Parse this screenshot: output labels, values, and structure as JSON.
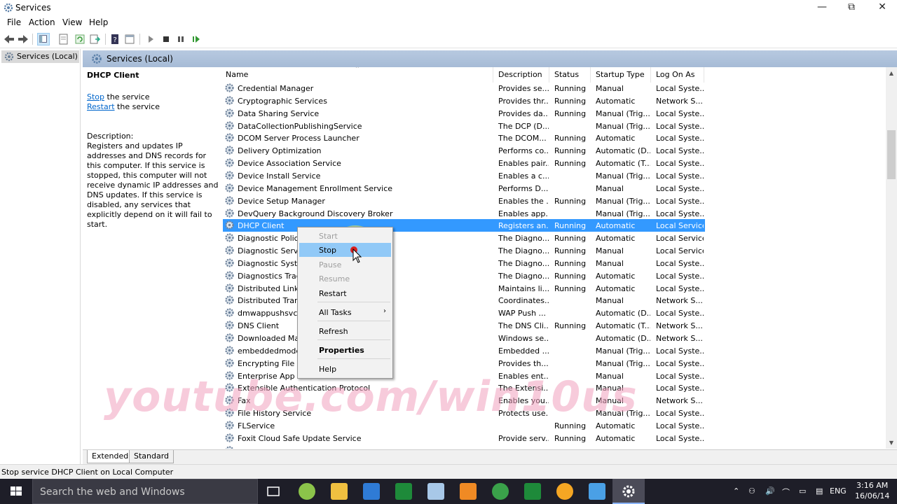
{
  "window": {
    "title": "Services",
    "minimize": "—",
    "maximize": "⧉",
    "close": "✕"
  },
  "menu": [
    "File",
    "Action",
    "View",
    "Help"
  ],
  "tree": {
    "item": "Services (Local)"
  },
  "pane": {
    "header": "Services (Local)",
    "detail": {
      "title": "DHCP Client",
      "stop_link": "Stop",
      "stop_rest": " the service",
      "restart_link": "Restart",
      "restart_rest": " the service",
      "description_label": "Description:",
      "description": "Registers and updates IP addresses and DNS records for this computer. If this service is stopped, this computer will not receive dynamic IP addresses and DNS updates. If this service is disabled, any services that explicitly depend on it will fail to start."
    },
    "columns": {
      "name": "Name",
      "description": "Description",
      "status": "Status",
      "startup": "Startup Type",
      "logon": "Log On As"
    },
    "rows": [
      {
        "name": "Credential Manager",
        "desc": "Provides se...",
        "status": "Running",
        "startup": "Manual",
        "logon": "Local Syste..."
      },
      {
        "name": "Cryptographic Services",
        "desc": "Provides thr...",
        "status": "Running",
        "startup": "Automatic",
        "logon": "Network S..."
      },
      {
        "name": "Data Sharing Service",
        "desc": "Provides da...",
        "status": "Running",
        "startup": "Manual (Trig...",
        "logon": "Local Syste..."
      },
      {
        "name": "DataCollectionPublishingService",
        "desc": "The DCP (D...",
        "status": "",
        "startup": "Manual (Trig...",
        "logon": "Local Syste..."
      },
      {
        "name": "DCOM Server Process Launcher",
        "desc": "The DCOM...",
        "status": "Running",
        "startup": "Automatic",
        "logon": "Local Syste..."
      },
      {
        "name": "Delivery Optimization",
        "desc": "Performs co...",
        "status": "Running",
        "startup": "Automatic (D...",
        "logon": "Local Syste..."
      },
      {
        "name": "Device Association Service",
        "desc": "Enables pair...",
        "status": "Running",
        "startup": "Automatic (T...",
        "logon": "Local Syste..."
      },
      {
        "name": "Device Install Service",
        "desc": "Enables a c...",
        "status": "",
        "startup": "Manual (Trig...",
        "logon": "Local Syste..."
      },
      {
        "name": "Device Management Enrollment Service",
        "desc": "Performs D...",
        "status": "",
        "startup": "Manual",
        "logon": "Local Syste..."
      },
      {
        "name": "Device Setup Manager",
        "desc": "Enables the ...",
        "status": "Running",
        "startup": "Manual (Trig...",
        "logon": "Local Syste..."
      },
      {
        "name": "DevQuery Background Discovery Broker",
        "desc": "Enables app...",
        "status": "",
        "startup": "Manual (Trig...",
        "logon": "Local Syste..."
      },
      {
        "name": "DHCP Client",
        "desc": "Registers an...",
        "status": "Running",
        "startup": "Automatic",
        "logon": "Local Service"
      },
      {
        "name": "Diagnostic Policy",
        "desc": "The Diagno...",
        "status": "Running",
        "startup": "Automatic",
        "logon": "Local Service"
      },
      {
        "name": "Diagnostic Servic",
        "desc": "The Diagno...",
        "status": "Running",
        "startup": "Manual",
        "logon": "Local Service"
      },
      {
        "name": "Diagnostic Syster",
        "desc": "The Diagno...",
        "status": "Running",
        "startup": "Manual",
        "logon": "Local Syste..."
      },
      {
        "name": "Diagnostics Track",
        "desc": "The Diagno...",
        "status": "Running",
        "startup": "Automatic",
        "logon": "Local Syste..."
      },
      {
        "name": "Distributed Link T",
        "desc": "Maintains li...",
        "status": "Running",
        "startup": "Automatic",
        "logon": "Local Syste..."
      },
      {
        "name": "Distributed Trans",
        "desc": "Coordinates...",
        "status": "",
        "startup": "Manual",
        "logon": "Network S..."
      },
      {
        "name": "dmwappushsvc",
        "desc": "WAP Push ...",
        "status": "",
        "startup": "Automatic (D...",
        "logon": "Local Syste..."
      },
      {
        "name": "DNS Client",
        "desc": "The DNS Cli...",
        "status": "Running",
        "startup": "Automatic (T...",
        "logon": "Network S..."
      },
      {
        "name": "Downloaded Ma",
        "desc": "Windows se...",
        "status": "",
        "startup": "Automatic (D...",
        "logon": "Network S..."
      },
      {
        "name": "embeddedmode",
        "desc": "Embedded ...",
        "status": "",
        "startup": "Manual (Trig...",
        "logon": "Local Syste..."
      },
      {
        "name": "Encrypting File S",
        "desc": "Provides th...",
        "status": "",
        "startup": "Manual (Trig...",
        "logon": "Local Syste..."
      },
      {
        "name": "Enterprise App M",
        "desc": "Enables ent...",
        "status": "",
        "startup": "Manual",
        "logon": "Local Syste..."
      },
      {
        "name": "Extensible Authentication Protocol",
        "desc": "The Extensi...",
        "status": "",
        "startup": "Manual",
        "logon": "Local Syste..."
      },
      {
        "name": "Fax",
        "desc": "Enables you...",
        "status": "",
        "startup": "Manual",
        "logon": "Network S..."
      },
      {
        "name": "File History Service",
        "desc": "Protects use...",
        "status": "",
        "startup": "Manual (Trig...",
        "logon": "Local Syste..."
      },
      {
        "name": "FLService",
        "desc": "",
        "status": "Running",
        "startup": "Automatic",
        "logon": "Local Syste..."
      },
      {
        "name": "Foxit Cloud Safe Update Service",
        "desc": "Provide serv...",
        "status": "Running",
        "startup": "Automatic",
        "logon": "Local Syste..."
      },
      {
        "name": "",
        "desc": "",
        "status": "",
        "startup": "",
        "logon": ""
      }
    ],
    "selected_row": 11
  },
  "context_menu": {
    "start": "Start",
    "stop": "Stop",
    "pause": "Pause",
    "resume": "Resume",
    "restart": "Restart",
    "all_tasks": "All Tasks",
    "refresh": "Refresh",
    "properties": "Properties",
    "help": "Help"
  },
  "tabs": [
    "Extended",
    "Standard"
  ],
  "status_text": "Stop service DHCP Client on Local Computer",
  "watermark": "youtube.com/win10us",
  "taskbar": {
    "search_placeholder": "Search the web and Windows",
    "lang": "ENG",
    "time": "3:16 AM",
    "date": "16/06/14"
  },
  "colors": {
    "selection": "#3399ff",
    "menu_hot": "#91c9f7",
    "header": "#b7c9e0",
    "taskbar": "#1e1e28"
  }
}
